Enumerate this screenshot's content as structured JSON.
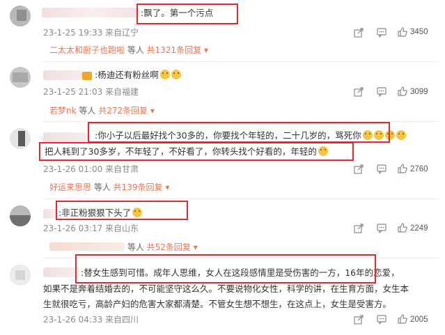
{
  "comments": [
    {
      "text": ":飘了。第一个污点",
      "meta": "23-1-25 19:33 来自辽宁",
      "likes": "3450",
      "thread": {
        "users": "二太太和厨子也跑啦",
        "mid": " 等人 ",
        "count": "共1321条回复"
      }
    },
    {
      "text": ":杨迪还有粉丝啊",
      "meta": "23-1-25 21:03 来自福建",
      "likes": "3099",
      "thread": {
        "users": "若梦nk",
        "mid": " 等人 ",
        "count": "共272条回复"
      }
    },
    {
      "text_line1": ":你小子以后最好找个30多的，你要找个年轻的，二十几岁的，骂死你",
      "text_line2": "把人耗到了30多岁，不年轻了，不好看了，你转头找个好看的，年轻的",
      "meta": "23-1-26 01:00 来自甘肃",
      "likes": "2760",
      "thread": {
        "users": "好运来思思",
        "mid": " 等人 ",
        "count": "共139条回复"
      }
    },
    {
      "text": ":非正粉狠狠下头了",
      "meta": "23-1-26 03:17 来自山东",
      "likes": "2249",
      "thread": {
        "users": "",
        "mid": " 等人 ",
        "count": "共52条回复"
      }
    },
    {
      "text_line1": ":替女生感到可惜。成年人思维，女人在这段感情里是受伤害的一方，16年的恋爱，",
      "text_line2": "如果不是奔着结婚去的，不可能坚守这么久。不要说物化女性，科学的讲，在生育方面，女生本",
      "text_line3": "生就很吃亏，高龄产妇的危害大家都清楚。不管女生想不想生，在这点上，女生是受害方。",
      "meta": "23-1-26 04:33 来自四川",
      "likes": "2005"
    }
  ],
  "icons": [
    "share-icon",
    "comment-icon",
    "like-icon"
  ],
  "colors": {
    "highlight": "#e8262d",
    "link": "#eb7350",
    "meta": "#8a8a8a"
  }
}
